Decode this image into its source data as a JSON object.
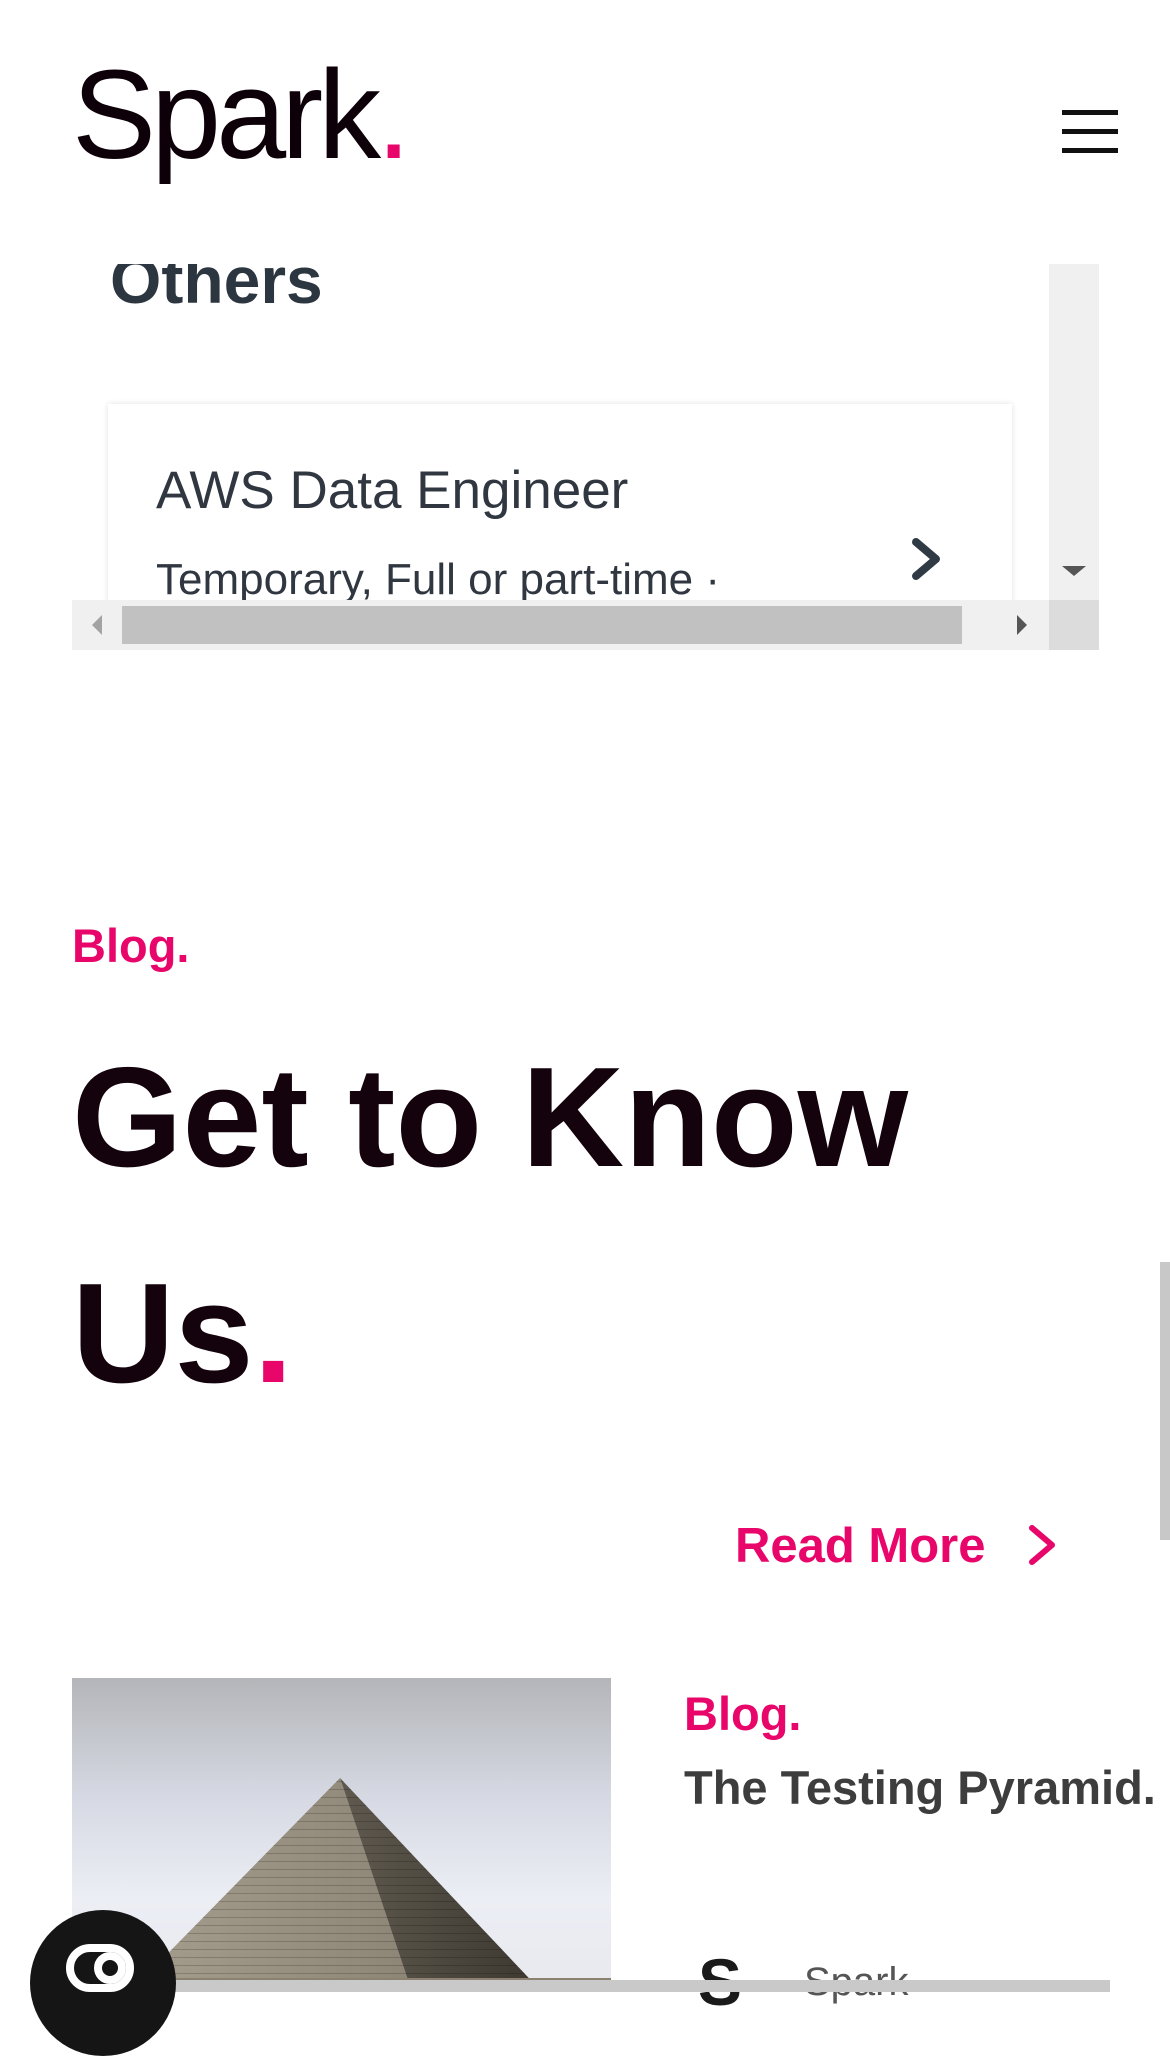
{
  "header": {
    "logo_text": "Spark",
    "logo_dot": ".",
    "menu_icon": "hamburger-icon"
  },
  "jobs_widget": {
    "section_title": "Others",
    "job": {
      "title": "AWS Data Engineer",
      "meta": "Temporary, Full or part-time  ·",
      "chevron_icon": "chevron-right-icon"
    }
  },
  "blog": {
    "eyebrow": "Blog.",
    "headline_line1": "Get to Know",
    "headline_line2": "Us",
    "headline_dot": ".",
    "read_more_label": "Read More",
    "read_more_icon": "chevron-right-icon",
    "card": {
      "eyebrow": "Blog.",
      "title": "The Testing Pyramid.",
      "author_initial": "S",
      "author_name": "Spark"
    }
  },
  "chat_widget": {
    "icon": "chat-icon"
  },
  "colors": {
    "accent": "#e8066b",
    "text_dark": "#14030d",
    "card_title": "#3d3d3d"
  }
}
